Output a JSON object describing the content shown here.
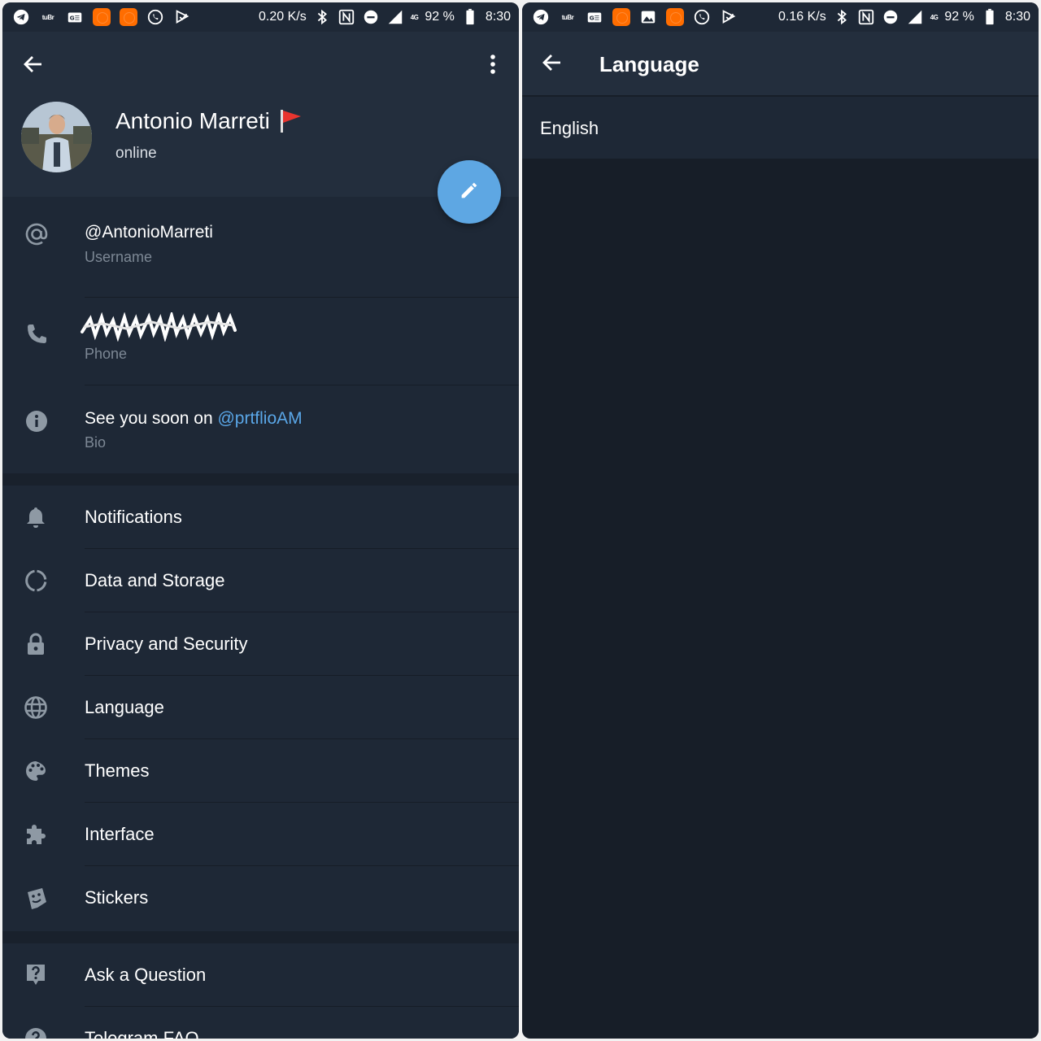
{
  "colors": {
    "header_bg": "#232e3d",
    "panel_bg": "#1e2836",
    "accent": "#5ea7e3",
    "link": "#5aa7e8",
    "secondary_text": "#7d8895",
    "icon": "#8e99a4"
  },
  "left": {
    "status": {
      "speed": "0.20 K/s",
      "battery": "92 %",
      "time": "8:30",
      "network": "4G",
      "icons": [
        "telegram-icon",
        "tuner-text-icon",
        "ge-card-icon",
        "mi-app-icon",
        "mi-app-icon",
        "whatsapp-icon",
        "play-flag-icon",
        "bluetooth-icon",
        "nfc-icon",
        "do-not-disturb-icon",
        "signal-icon",
        "battery-icon"
      ]
    },
    "profile": {
      "name": "Antonio Marreti",
      "status": "online"
    },
    "info": [
      {
        "value": "@AntonioMarreti",
        "label": "Username",
        "icon": "at-icon"
      },
      {
        "value": "",
        "label": "Phone",
        "icon": "phone-icon"
      },
      {
        "value_prefix": "See you soon on ",
        "value_link": "@prtflioAM",
        "label": "Bio",
        "icon": "info-icon"
      }
    ],
    "menu": [
      {
        "label": "Notifications",
        "icon": "bell-icon"
      },
      {
        "label": "Data and Storage",
        "icon": "data-circle-icon"
      },
      {
        "label": "Privacy and Security",
        "icon": "lock-icon"
      },
      {
        "label": "Language",
        "icon": "globe-icon"
      },
      {
        "label": "Themes",
        "icon": "palette-icon"
      },
      {
        "label": "Interface",
        "icon": "puzzle-icon"
      },
      {
        "label": "Stickers",
        "icon": "sticker-icon"
      }
    ],
    "help": [
      {
        "label": "Ask a Question",
        "icon": "question-bubble-icon"
      },
      {
        "label": "Telegram FAQ",
        "icon": "help-circle-icon"
      }
    ]
  },
  "right": {
    "status": {
      "speed": "0.16 K/s",
      "battery": "92 %",
      "time": "8:30",
      "network": "4G"
    },
    "title": "Language",
    "languages": [
      "English"
    ]
  }
}
